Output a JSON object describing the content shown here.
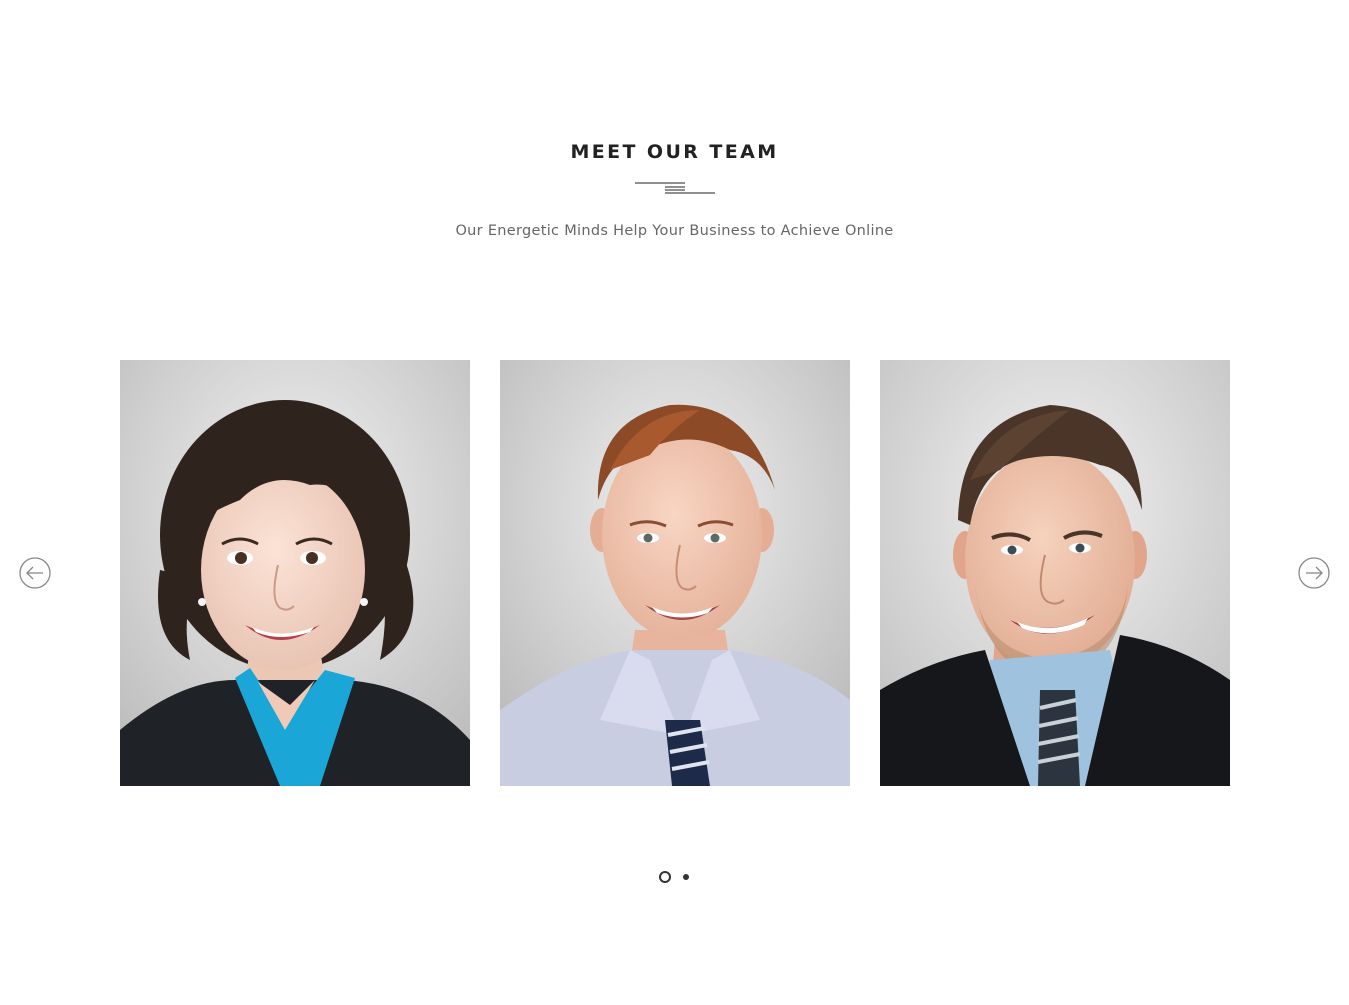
{
  "section": {
    "title": "MEET OUR TEAM",
    "subtitle": "Our Energetic Minds Help Your Business to Achieve Online"
  },
  "carousel": {
    "prev_icon": "arrow-left-circle-icon",
    "next_icon": "arrow-right-circle-icon",
    "members": [
      {
        "photo": "woman-curly-hair-blue-blouse-portrait"
      },
      {
        "photo": "man-red-hair-striped-tie-portrait"
      },
      {
        "photo": "man-beard-dark-suit-portrait"
      }
    ],
    "pagination": {
      "pages": 2,
      "active": 1
    }
  },
  "colors": {
    "title": "#222222",
    "subtitle": "#666666",
    "arrow": "#888888",
    "dot": "#333333"
  }
}
